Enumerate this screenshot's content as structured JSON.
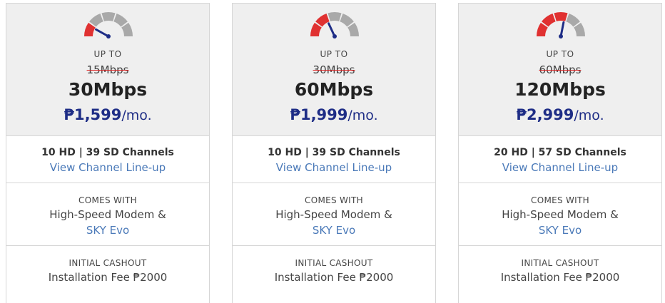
{
  "colors": {
    "accent_blue": "#1e2d86",
    "link_blue": "#4a79b8",
    "gauge_red": "#e03131",
    "gauge_gray": "#a9a9a9",
    "needle": "#1e2d86",
    "header_bg": "#efefef"
  },
  "plans": [
    {
      "up_to": "UP TO",
      "old_speed": "15Mbps",
      "speed": "30Mbps",
      "price": "₱1,599",
      "per": "/mo.",
      "gauge_level": 0.2,
      "channels": "10 HD | 39 SD Channels",
      "lineup_link": "View Channel Line-up",
      "comes_with_label": "COMES WITH",
      "comes_with_text": "High-Speed Modem &",
      "comes_with_link": "SKY Evo",
      "cashout_label": "INITIAL CASHOUT",
      "cashout_text": "Installation Fee ₱2000"
    },
    {
      "up_to": "UP TO",
      "old_speed": "30Mbps",
      "speed": "60Mbps",
      "price": "₱1,999",
      "per": "/mo.",
      "gauge_level": 0.4,
      "channels": "10 HD | 39 SD Channels",
      "lineup_link": "View Channel Line-up",
      "comes_with_label": "COMES WITH",
      "comes_with_text": "High-Speed Modem &",
      "comes_with_link": "SKY Evo",
      "cashout_label": "INITIAL CASHOUT",
      "cashout_text": "Installation Fee ₱2000"
    },
    {
      "up_to": "UP TO",
      "old_speed": "60Mbps",
      "speed": "120Mbps",
      "price": "₱2,999",
      "per": "/mo.",
      "gauge_level": 0.6,
      "channels": "20 HD | 57 SD Channels",
      "lineup_link": "View Channel Line-up",
      "comes_with_label": "COMES WITH",
      "comes_with_text": "High-Speed Modem &",
      "comes_with_link": "SKY Evo",
      "cashout_label": "INITIAL CASHOUT",
      "cashout_text": "Installation Fee ₱2000"
    }
  ]
}
